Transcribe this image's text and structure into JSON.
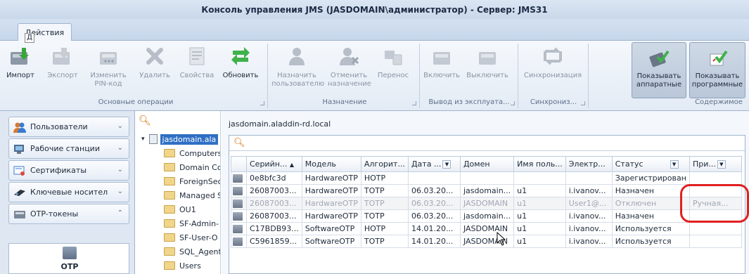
{
  "window": {
    "title": "Консоль управления JMS (JASDOMAIN\\администратор) - Сервер: JMS31"
  },
  "ribbon_tab": {
    "label": "Действия",
    "keytip": "Д"
  },
  "ribbon": {
    "import": {
      "label": "Импорт",
      "icon": "import-icon"
    },
    "export": {
      "label": "Экспорт",
      "icon": "export-icon"
    },
    "change_pin": {
      "label": "Изменить PIN-код",
      "icon": "change-pin-icon"
    },
    "delete": {
      "label": "Удалить",
      "icon": "delete-icon"
    },
    "properties": {
      "label": "Свойства",
      "icon": "properties-icon"
    },
    "refresh": {
      "label": "Обновить",
      "icon": "refresh-icon"
    },
    "assign_user": {
      "label": "Назначить пользователю",
      "icon": "assign-user-icon"
    },
    "unassign": {
      "label": "Отменить назначение",
      "icon": "unassign-icon"
    },
    "move": {
      "label": "Перенос",
      "icon": "move-icon"
    },
    "enable": {
      "label": "Включить",
      "icon": "enable-icon"
    },
    "disable": {
      "label": "Выключить",
      "icon": "disable-icon"
    },
    "sync": {
      "label": "Синхронизация",
      "icon": "sync-icon"
    },
    "show_hardware": {
      "label": "Показывать аппаратные",
      "icon": "show-hardware-icon"
    },
    "show_software": {
      "label": "Показывать программные",
      "icon": "show-software-icon"
    },
    "groups": {
      "basic": "Основные операции",
      "assignment": "Назначение",
      "decommission": "Вывод из эксплуата...",
      "sync": "Синхрониз...",
      "content": "Содержимое"
    }
  },
  "nav": {
    "items": [
      {
        "label": "Пользователи",
        "icon": "users-icon",
        "chevron": "⌄"
      },
      {
        "label": "Рабочие станции",
        "icon": "workstations-icon",
        "chevron": "⌄"
      },
      {
        "label": "Сертификаты",
        "icon": "certificates-icon",
        "chevron": "⌄"
      },
      {
        "label": "Ключевые носител",
        "icon": "key-media-icon",
        "chevron": "⌄"
      },
      {
        "label": "OTP-токены",
        "icon": "otp-tokens-icon",
        "chevron": "⌃"
      }
    ],
    "big_item": {
      "label": "OTP"
    }
  },
  "tree": {
    "root": "jasdomain.ala",
    "children": [
      "Computers",
      "Domain Co",
      "ForeignSec",
      "Managed S",
      "OU1",
      "SF-Admin-",
      "SF-User-O",
      "SQL_Agent",
      "Users"
    ]
  },
  "main": {
    "path": "jasdomain.aladdin-rd.local",
    "columns": [
      "Серийн...",
      "Модель",
      "Алгорит...",
      "Дата ...",
      "Домен",
      "Имя поль...",
      "Электр...",
      "Статус",
      "При..."
    ],
    "sort_indicator": "▲",
    "filter_glyph": "▼",
    "rows": [
      {
        "serial": "0e8bfc3d",
        "model": "HardwareOTP",
        "algo": "HOTP",
        "date": "",
        "domain": "",
        "user": "",
        "email": "",
        "status": "Зарегистрирован",
        "note": "",
        "disabled": false
      },
      {
        "serial": "26087003...",
        "model": "HardwareOTP",
        "algo": "TOTP",
        "date": "06.03.20...",
        "domain": "jasdomain...",
        "user": "u1",
        "email": "i.ivanov...",
        "status": "Назначен",
        "note": "",
        "disabled": false
      },
      {
        "serial": "26087003...",
        "model": "HardwareOTP",
        "algo": "TOTP",
        "date": "06.03.20...",
        "domain": "JASDOMAIN",
        "user": "u1",
        "email": "User1@...",
        "status": "Отключен",
        "note": "Ручная...",
        "disabled": true
      },
      {
        "serial": "26087003...",
        "model": "HardwareOTP",
        "algo": "TOTP",
        "date": "06.03.20...",
        "domain": "jasdomain...",
        "user": "u1",
        "email": "i.ivanov...",
        "status": "Назначен",
        "note": "",
        "disabled": false
      },
      {
        "serial": "C17BDB93...",
        "model": "SoftwareOTP",
        "algo": "HOTP",
        "date": "14.01.20...",
        "domain": "JASDOMAIN",
        "user": "u1",
        "email": "i.ivanov...",
        "status": "Используется",
        "note": "",
        "disabled": false
      },
      {
        "serial": "C5961859...",
        "model": "SoftwareOTP",
        "algo": "TOTP",
        "date": "14.01.20...",
        "domain": "JASDOMAIN",
        "user": "u1",
        "email": "i.ivanov...",
        "status": "Используется",
        "note": "",
        "disabled": false
      }
    ]
  },
  "colors": {
    "annotation": "#e02020",
    "accent": "#2f6fc4"
  }
}
